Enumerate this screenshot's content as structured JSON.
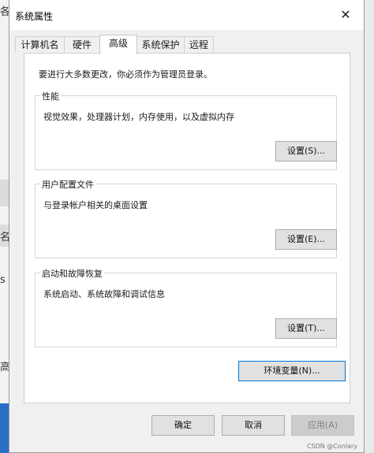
{
  "background": {
    "chars": [
      "各",
      "名",
      "s",
      "高"
    ]
  },
  "window": {
    "title": "系统属性",
    "close_glyph": "✕"
  },
  "tabs": [
    {
      "label": "计算机名"
    },
    {
      "label": "硬件"
    },
    {
      "label": "高级",
      "active": true
    },
    {
      "label": "系统保护"
    },
    {
      "label": "远程"
    }
  ],
  "panel": {
    "notice": "要进行大多数更改，你必须作为管理员登录。",
    "performance": {
      "legend": "性能",
      "description": "视觉效果，处理器计划，内存使用，以及虚拟内存",
      "button": "设置(S)..."
    },
    "user_profiles": {
      "legend": "用户配置文件",
      "description": "与登录帐户相关的桌面设置",
      "button": "设置(E)..."
    },
    "startup_recovery": {
      "legend": "启动和故障恢复",
      "description": "系统启动、系统故障和调试信息",
      "button": "设置(T)..."
    },
    "env_button": "环境变量(N)..."
  },
  "footer": {
    "ok": "确定",
    "cancel": "取消",
    "apply": "应用(A)"
  },
  "watermark": "CSDN @Conlary",
  "colors": {
    "accent": "#0078d7",
    "panel_bg": "#ffffff",
    "window_bg": "#f0f0f0"
  }
}
